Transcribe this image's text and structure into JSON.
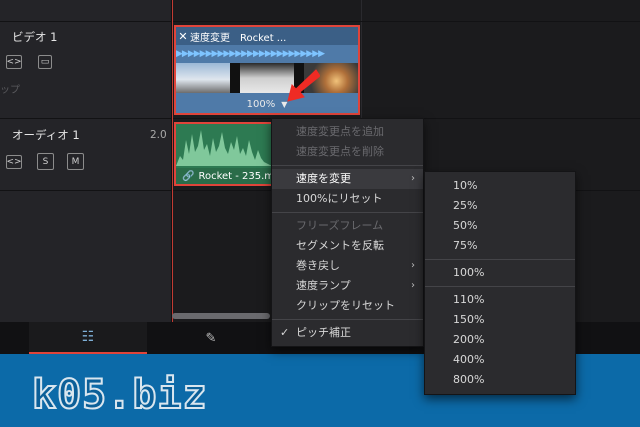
{
  "tracks": {
    "video": {
      "name": "ビデオ 1",
      "clip_label": "ップ"
    },
    "audio": {
      "name": "オーディオ 1",
      "level": "2.0",
      "solo": "S",
      "mute": "M"
    }
  },
  "video_clip": {
    "title": "速度変更　Rocket ...",
    "speed_label": "100%"
  },
  "audio_clip": {
    "title": "Rocket - 235.m"
  },
  "context_menu": {
    "items": [
      {
        "label": "速度変更点を追加",
        "disabled": true
      },
      {
        "label": "速度変更点を削除",
        "disabled": true
      },
      {
        "label": "速度を変更",
        "has_submenu": true,
        "highlighted": true
      },
      {
        "label": "100%にリセット"
      },
      {
        "label": "フリーズフレーム",
        "disabled": true
      },
      {
        "label": "セグメントを反転"
      },
      {
        "label": "巻き戻し",
        "has_submenu": true
      },
      {
        "label": "速度ランプ",
        "has_submenu": true
      },
      {
        "label": "クリップをリセット"
      },
      {
        "label": "ピッチ補正",
        "checked": true
      }
    ]
  },
  "speed_submenu": {
    "group1": [
      "10%",
      "25%",
      "50%",
      "75%"
    ],
    "group2": [
      "100%"
    ],
    "group3": [
      "110%",
      "150%",
      "200%",
      "400%",
      "800%"
    ]
  },
  "brand": {
    "text": "k05.biz"
  },
  "colors": {
    "accent_red": "#e0443a",
    "brand_blue": "#0c6aa8",
    "video_clip": "#4f7aa8",
    "audio_clip": "#2d7a52"
  }
}
